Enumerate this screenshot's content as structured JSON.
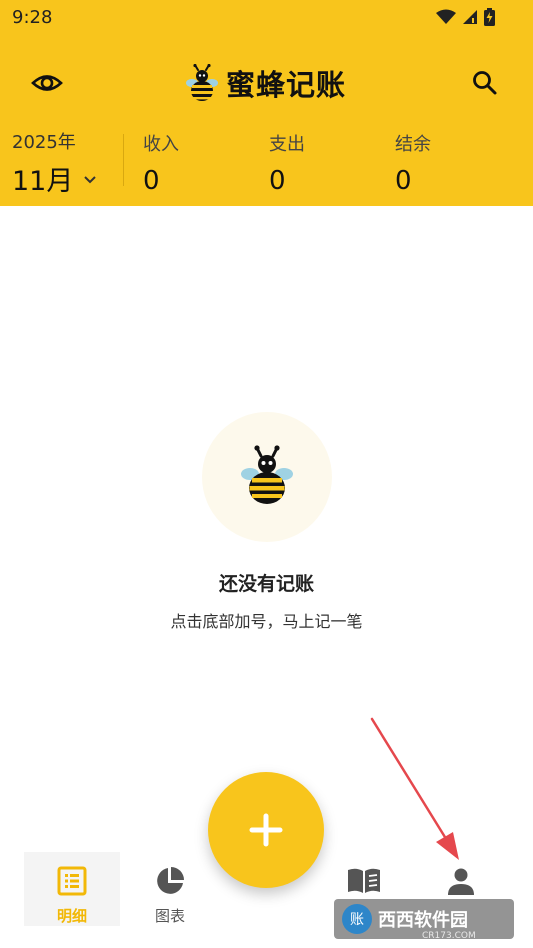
{
  "status_bar": {
    "time": "9:28",
    "icons": [
      "wifi-icon",
      "signal-icon",
      "battery-icon"
    ]
  },
  "header": {
    "left_icon": "eye-icon",
    "right_icon": "search-icon",
    "app_logo": "bee-logo-icon",
    "app_title": "蜜蜂记账"
  },
  "period": {
    "year": "2025年",
    "month": "11月",
    "dropdown_icon": "chevron-down-icon"
  },
  "stats": {
    "income_label": "收入",
    "income_value": "0",
    "expense_label": "支出",
    "expense_value": "0",
    "balance_label": "结余",
    "balance_value": "0"
  },
  "empty_state": {
    "icon": "bee-icon",
    "title": "还没有记账",
    "subtitle": "点击底部加号，马上记一笔"
  },
  "fab": {
    "icon": "plus-icon"
  },
  "bottom_nav": {
    "items": [
      {
        "label": "明细",
        "icon": "list-icon",
        "active": true
      },
      {
        "label": "图表",
        "icon": "pie-chart-icon",
        "active": false
      },
      {
        "label": "",
        "icon": "book-icon",
        "active": false
      },
      {
        "label": "",
        "icon": "person-icon",
        "active": false
      }
    ]
  },
  "annotation": {
    "icon": "red-arrow"
  },
  "watermark": {
    "logo_char": "账",
    "text": "西西软件园",
    "url": "CR173.COM"
  },
  "colors": {
    "accent": "#F8C51C",
    "active_tab": "#F2B807",
    "empty_circle": "#FDF9EC",
    "annotation": "#E5484D"
  }
}
